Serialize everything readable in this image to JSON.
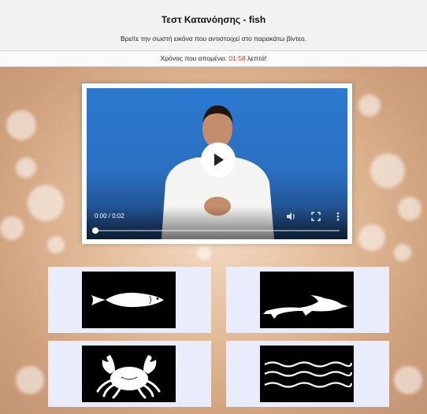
{
  "header": {
    "title": "Τεστ Κατανόησης - fish",
    "instruction": "Βρείτε την σωστή εικόνα που αντιστοιχεί στο παρακάτω βίντεο."
  },
  "timer": {
    "prefix": "Χρόνος που απομένει: ",
    "value": "01:58",
    "suffix": " λεπτά!"
  },
  "video": {
    "time_display": "0:00 / 0:02",
    "progress": 0
  },
  "choices": [
    {
      "icon": "fish-icon"
    },
    {
      "icon": "dolphin-icon"
    },
    {
      "icon": "crab-icon"
    },
    {
      "icon": "water-waves-icon"
    }
  ],
  "colors": {
    "timer_value": "#e0342c",
    "choice_background": "#e9ecfb",
    "video_background": "#2c7ad0"
  }
}
